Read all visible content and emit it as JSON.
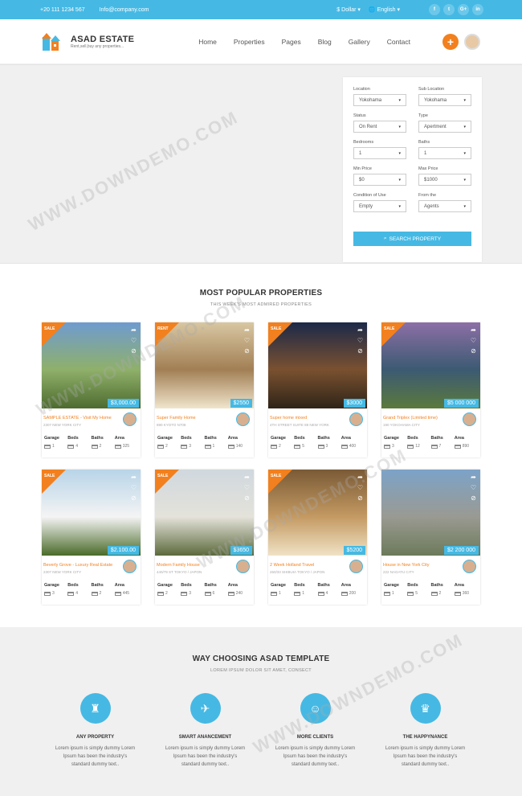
{
  "topbar": {
    "phone": "+20 111 1234 567",
    "email": "Info@company.com",
    "currency": "$ Dollar",
    "language": "English",
    "social": [
      "f",
      "t",
      "G+",
      "in"
    ]
  },
  "header": {
    "logo_title": "ASAD ESTATE",
    "logo_sub": "Rent,sell,buy any properties...",
    "nav": [
      "Home",
      "Properties",
      "Pages",
      "Blog",
      "Gallery",
      "Contact"
    ]
  },
  "search": {
    "fields": [
      {
        "label": "Location",
        "value": "Yokohama"
      },
      {
        "label": "Sub Location",
        "value": "Yokohama"
      },
      {
        "label": "Status",
        "value": "On Rent"
      },
      {
        "label": "Type",
        "value": "Apertment"
      },
      {
        "label": "Bedrooms",
        "value": "1"
      },
      {
        "label": "Baths",
        "value": "1"
      },
      {
        "label": "Min Price",
        "value": "$0"
      },
      {
        "label": "Max Price",
        "value": "$1000"
      },
      {
        "label": "Condition of Use",
        "value": "Empty"
      },
      {
        "label": "From the",
        "value": "Agents"
      }
    ],
    "button": "SEARCH PROPERTY"
  },
  "popular": {
    "title": "MOST POPULAR PROPERTIES",
    "subtitle": "THIS WEEK'S MOST ADMIRED PROPERTIES"
  },
  "feature_labels": [
    "Garage",
    "Beds",
    "Baths",
    "Area"
  ],
  "properties": [
    {
      "ribbon": "SALE",
      "price": "$3,000.00",
      "name": "SAMPLE ESTATE - Visit My Home",
      "address": "2307 NEW YORK CITY",
      "values": [
        "1",
        "4",
        "2",
        "325"
      ],
      "colors": [
        "#6f9bd0",
        "#8fb06a",
        "#4d6b2f"
      ]
    },
    {
      "ribbon": "RENT",
      "price": "$2550",
      "name": "Super Family Home",
      "address": "890 KYOTO N708",
      "values": [
        "2",
        "3",
        "1",
        "140"
      ],
      "colors": [
        "#d8c7a2",
        "#a27f55",
        "#f0e5cc"
      ]
    },
    {
      "ribbon": "SALE",
      "price": "$3000",
      "name": "Super home mixed",
      "address": "4TH STREET SUITE 88 NEW YORK",
      "values": [
        "2",
        "5",
        "3",
        "400"
      ],
      "colors": [
        "#1c2948",
        "#7a5130",
        "#2e2418"
      ]
    },
    {
      "ribbon": "SALE",
      "price": "$5 000 000",
      "name": "Grand Triplex (Limited time)",
      "address": "190 YOKOHAMA CITY",
      "values": [
        "3",
        "12",
        "7",
        "890"
      ],
      "colors": [
        "#8c6fa6",
        "#3c5a72",
        "#5b7a3c"
      ]
    },
    {
      "ribbon": "SALE",
      "price": "$2.100.00",
      "name": "Beverly Grove - Luxury Real Estate",
      "address": "2307 NEW YORK CITY",
      "values": [
        "3",
        "4",
        "2",
        "445"
      ],
      "colors": [
        "#b8d4e8",
        "#f4f4f4",
        "#4a6b2a"
      ]
    },
    {
      "ribbon": "SALE",
      "price": "$3650",
      "name": "Modern Family House",
      "address": "440/79 ST TOKYO / JAPON",
      "values": [
        "2",
        "3",
        "6",
        "240"
      ],
      "colors": [
        "#d0d8de",
        "#e4e2da",
        "#5c6a3c"
      ]
    },
    {
      "ribbon": "SALE",
      "price": "$5200",
      "name": "2 Week Holland Travel",
      "address": "260/33 SHIBUIA TOKYO / JAPON",
      "values": [
        "1",
        "1",
        "4",
        "200"
      ],
      "colors": [
        "#7a5a36",
        "#c49a62",
        "#f0e2c6"
      ]
    },
    {
      "ribbon": "",
      "price": "$2 200 000",
      "name": "House in New York City",
      "address": "222 NAGATU CITY",
      "values": [
        "1",
        "5",
        "2",
        "360"
      ],
      "colors": [
        "#7ca3c8",
        "#9a9a92",
        "#6c7a5a"
      ]
    }
  ],
  "why": {
    "title": "WAY CHOOSING ASAD TEMPLATE",
    "subtitle": "LOREM IPSUM DOLOR SIT AMET, CONSECT",
    "items": [
      {
        "title": "ANY PROPERTY",
        "text": "Lorem ipsum is simply dummy Lorem Ipsum has been the industry's standard dummy text.."
      },
      {
        "title": "SMART ANANCEMENT",
        "text": "Lorem ipsum is simply dummy Lorem Ipsum has been the industry's standard dummy text.."
      },
      {
        "title": "MORE CLIENTS",
        "text": "Lorem ipsum is simply dummy Lorem Ipsum has been the industry's standard dummy text.."
      },
      {
        "title": "THE HAPPYNANCE",
        "text": "Lorem ipsum is simply dummy Lorem Ipsum has been the industry's standard dummy text.."
      }
    ]
  },
  "watermark": "WWW.DOWNDEMO.COM",
  "colors": {
    "accent": "#45b9e4",
    "orange": "#f2801e"
  }
}
